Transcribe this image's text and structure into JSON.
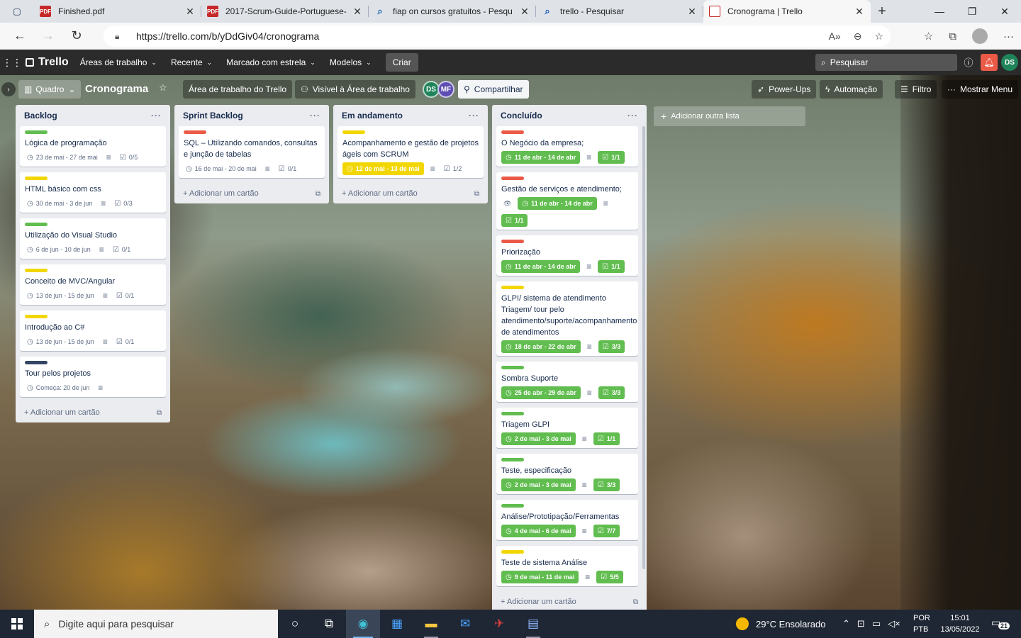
{
  "browser": {
    "tabs": [
      {
        "title": "Finished.pdf",
        "icon": "pdf-icon"
      },
      {
        "title": "2017-Scrum-Guide-Portuguese-",
        "icon": "pdf-icon"
      },
      {
        "title": "fiap on cursos gratuitos - Pesqu",
        "icon": "search-icon"
      },
      {
        "title": "trello - Pesquisar",
        "icon": "search-icon"
      },
      {
        "title": "Cronograma | Trello",
        "icon": "trello-icon"
      }
    ],
    "url": "https://trello.com/b/yDdGiv04/cronograma"
  },
  "header": {
    "logo": "Trello",
    "menus": [
      "Áreas de trabalho",
      "Recente",
      "Marcado com estrela",
      "Modelos"
    ],
    "create": "Criar",
    "search_placeholder": "Pesquisar",
    "user_initials": "DS"
  },
  "board": {
    "view": "Quadro",
    "title": "Cronograma",
    "workspace": "Área de trabalho do Trello",
    "visibility": "Visível à Área de trabalho",
    "members": [
      "DS",
      "MF"
    ],
    "share": "Compartilhar",
    "powerups": "Power-Ups",
    "automation": "Automação",
    "filter": "Filtro",
    "menu": "Mostrar Menu",
    "add_list": "Adicionar outra lista",
    "add_card": "Adicionar um cartão"
  },
  "colors": {
    "green": "#61bd4f",
    "yellow": "#f2d600",
    "red": "#eb5a46",
    "navy": "#344563"
  },
  "lists": [
    {
      "name": "Backlog",
      "cards": [
        {
          "label": "green",
          "title": "Lógica de programação",
          "date": "23 de mai - 27 de mai",
          "checklist": "0/5"
        },
        {
          "label": "yellow",
          "title": "HTML básico com css",
          "date": "30 de mai - 3 de jun",
          "checklist": "0/3"
        },
        {
          "label": "green",
          "title": "Utilização do Visual Studio",
          "date": "6 de jun - 10 de jun",
          "checklist": "0/1"
        },
        {
          "label": "yellow",
          "title": "Conceito de MVC/Angular",
          "date": "13 de jun - 15 de jun",
          "checklist": "0/1"
        },
        {
          "label": "yellow",
          "title": "Introdução ao C#",
          "date": "13 de jun - 15 de jun",
          "checklist": "0/1"
        },
        {
          "label": "navy",
          "title": "Tour pelos projetos",
          "date": "Começa: 20 de jun",
          "checklist": ""
        }
      ]
    },
    {
      "name": "Sprint Backlog",
      "cards": [
        {
          "label": "red",
          "title": "SQL – Utilizando comandos, consultas e junção de tabelas",
          "date": "16 de mai - 20 de mai",
          "checklist": "0/1"
        }
      ]
    },
    {
      "name": "Em andamento",
      "cards": [
        {
          "label": "yellow",
          "title": "Acompanhamento e gestão de projetos ágeis com SCRUM",
          "date": "12 de mai - 13 de mai",
          "checklist": "1/2",
          "date_style": "yellow"
        }
      ]
    },
    {
      "name": "Concluído",
      "cards": [
        {
          "label": "red",
          "title": "O Negócio da empresa;",
          "date": "11 de abr - 14 de abr",
          "checklist": "1/1"
        },
        {
          "label": "red",
          "title": "Gestão de serviços e atendimento;",
          "date": "11 de abr - 14 de abr",
          "checklist": "1/1",
          "watch": true
        },
        {
          "label": "red",
          "title": "Priorização",
          "date": "11 de abr - 14 de abr",
          "checklist": "1/1"
        },
        {
          "label": "yellow",
          "title": "GLPI/ sistema de atendimento Triagem/ tour pelo atendimento/suporte/acompanhamento de atendimentos",
          "date": "18 de abr - 22 de abr",
          "checklist": "3/3"
        },
        {
          "label": "green",
          "title": "Sombra Suporte",
          "date": "25 de abr - 29 de abr",
          "checklist": "3/3"
        },
        {
          "label": "green",
          "title": "Triagem GLPI",
          "date": "2 de mai - 3 de mai",
          "checklist": "1/1"
        },
        {
          "label": "green",
          "title": "Teste, especificação",
          "date": "2 de mai - 3 de mai",
          "checklist": "3/3"
        },
        {
          "label": "green",
          "title": "Análise/Prototipação/Ferramentas",
          "date": "4 de mai - 6 de mai",
          "checklist": "7/7"
        },
        {
          "label": "yellow",
          "title": "Teste de sistema Análise",
          "date": "9 de mai - 11 de mai",
          "checklist": "5/5"
        }
      ]
    }
  ],
  "taskbar": {
    "search_placeholder": "Digite aqui para pesquisar",
    "weather": "29°C  Ensolarado",
    "lang1": "POR",
    "lang2": "PTB",
    "time": "15:01",
    "date": "13/05/2022",
    "notifications": "21"
  }
}
